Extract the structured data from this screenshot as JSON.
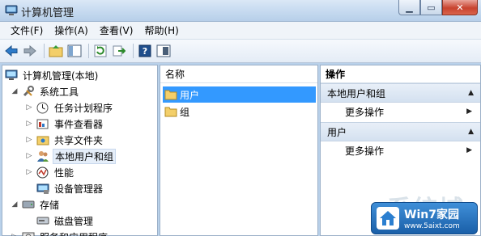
{
  "window": {
    "title": "计算机管理",
    "minimize_label": "▁",
    "maximize_label": "▭",
    "close_label": "✕"
  },
  "menu": [
    "文件(F)",
    "操作(A)",
    "查看(V)",
    "帮助(H)"
  ],
  "toolbar": [
    "back-arrow-icon",
    "forward-arrow-icon",
    "up-folder-icon",
    "show-hide-tree-icon",
    "refresh-icon",
    "export-icon",
    "help-icon",
    "panel-icon"
  ],
  "tree": {
    "root": "计算机管理(本地)",
    "system_tools": "系统工具",
    "items": [
      "任务计划程序",
      "事件查看器",
      "共享文件夹",
      "本地用户和组",
      "性能",
      "设备管理器"
    ],
    "storage": "存储",
    "disk": "磁盘管理",
    "services": "服务和应用程序"
  },
  "list": {
    "column": "名称",
    "rows": [
      "用户",
      "组"
    ]
  },
  "actions": {
    "header": "操作",
    "group1": "本地用户和组",
    "more1": "更多操作",
    "group2": "用户",
    "more2": "更多操作"
  },
  "watermark": {
    "big": "系统城",
    "brand": "Win7家园",
    "url": "www.5aixt.com"
  }
}
